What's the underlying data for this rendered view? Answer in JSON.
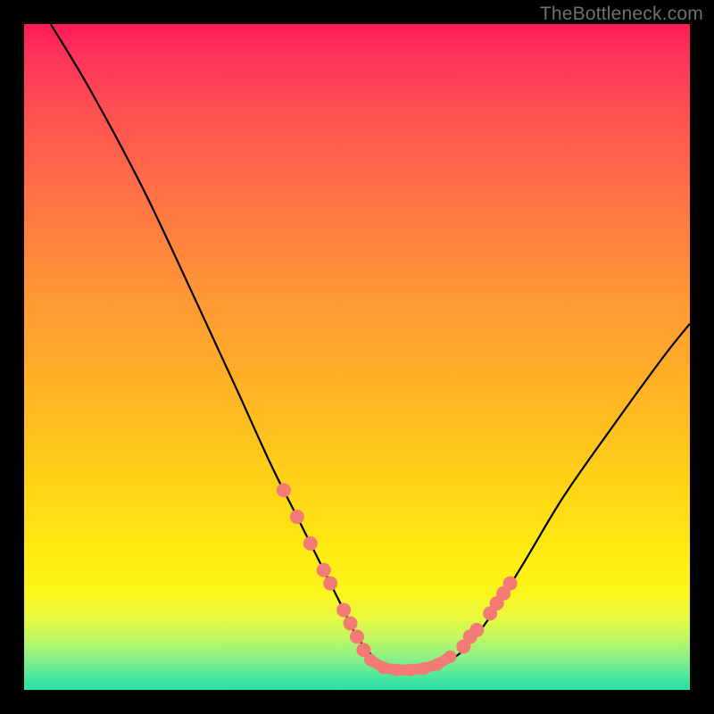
{
  "watermark": "TheBottleneck.com",
  "chart_data": {
    "type": "line",
    "title": "",
    "xlabel": "",
    "ylabel": "",
    "xlim": [
      0,
      100
    ],
    "ylim": [
      0,
      100
    ],
    "series": [
      {
        "name": "curve",
        "points": [
          [
            4,
            100
          ],
          [
            10,
            90
          ],
          [
            18,
            75
          ],
          [
            26,
            58
          ],
          [
            32,
            45
          ],
          [
            37,
            34
          ],
          [
            41,
            26
          ],
          [
            45,
            18
          ],
          [
            48,
            12
          ],
          [
            50,
            8
          ],
          [
            53,
            4.5
          ],
          [
            56,
            3
          ],
          [
            60,
            3
          ],
          [
            63,
            4
          ],
          [
            66,
            6
          ],
          [
            70,
            11
          ],
          [
            75,
            19
          ],
          [
            81,
            29
          ],
          [
            88,
            39
          ],
          [
            96,
            50
          ],
          [
            100,
            55
          ]
        ]
      },
      {
        "name": "highlight-dots-left",
        "x": [
          39,
          41,
          43,
          45,
          46,
          48,
          49,
          50,
          51
        ],
        "y": [
          30,
          26,
          22,
          18,
          16,
          12,
          10,
          8,
          6
        ]
      },
      {
        "name": "highlight-track",
        "x": [
          52,
          54,
          56,
          58,
          60,
          62,
          64
        ],
        "y": [
          4.5,
          3.3,
          3,
          3,
          3.2,
          3.8,
          5
        ]
      },
      {
        "name": "highlight-dots-right",
        "x": [
          66,
          67,
          68,
          70,
          71,
          72,
          73
        ],
        "y": [
          6.5,
          8,
          9,
          11.5,
          13,
          14.5,
          16
        ]
      }
    ]
  }
}
